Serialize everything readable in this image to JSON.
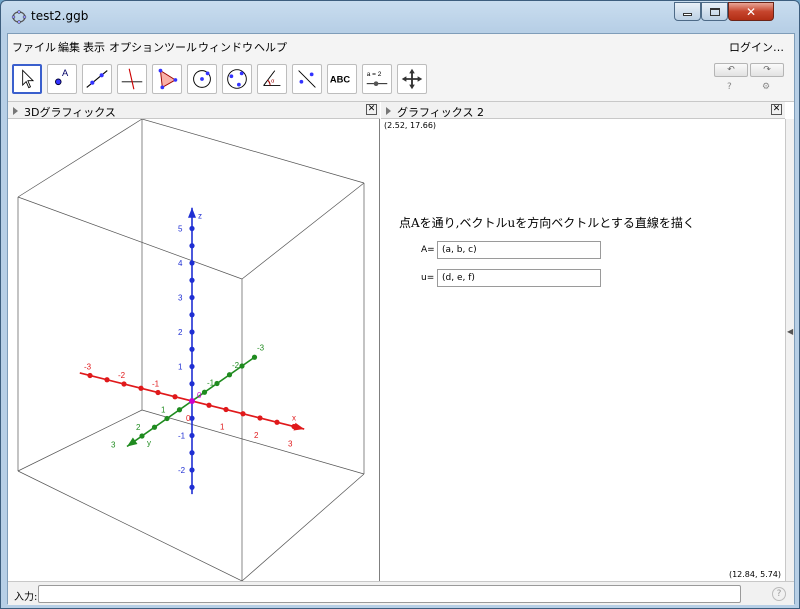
{
  "window": {
    "title": "test2.ggb"
  },
  "menu": {
    "items": [
      "ファイル",
      "編集",
      "表示",
      "オプション",
      "ツール",
      "ウィンドウ",
      "ヘルプ"
    ],
    "login": "ログイン…"
  },
  "toolbar": {
    "tools": [
      "move-tool-icon",
      "point-tool-icon",
      "line-tool-icon",
      "perpendicular-tool-icon",
      "polygon-tool-icon",
      "circle-tool-icon",
      "conic-tool-icon",
      "angle-tool-icon",
      "reflect-tool-icon",
      "text-tool-icon",
      "slider-tool-icon",
      "move-view-tool-icon"
    ],
    "text_label": "ABC",
    "slider_label": "a = 2",
    "undo": "↶",
    "redo": "↷"
  },
  "panels": {
    "view3d": {
      "title": "3Dグラフィックス"
    },
    "view2": {
      "title": "グラフィックス 2",
      "top_coord": "(2.52, 17.66)",
      "bottom_coord": "(12.84, 5.74)",
      "heading": "点Aを通り,ベクトルuを方向ベクトルとする直線を描く",
      "inputs": [
        {
          "label": "A=",
          "value": "(a, b, c)"
        },
        {
          "label": "u=",
          "value": "(d, e, f)"
        }
      ]
    }
  },
  "axes3d": {
    "z_label": "z",
    "y_label": "y",
    "x_label": "x",
    "z_ticks": [
      "5",
      "4",
      "3",
      "2",
      "1",
      "-1",
      "-2"
    ],
    "x_ticks": [
      "-3",
      "-2",
      "-1",
      "0",
      "1",
      "2",
      "3"
    ],
    "y_ticks": [
      "-3",
      "-2",
      "-1",
      "1",
      "2",
      "3"
    ],
    "origin_label": "0",
    "colors": {
      "x": "#e0191b",
      "y": "#1f8b1f",
      "z": "#1f2fd3"
    }
  },
  "inputbar": {
    "label": "入力:",
    "help": "?"
  }
}
